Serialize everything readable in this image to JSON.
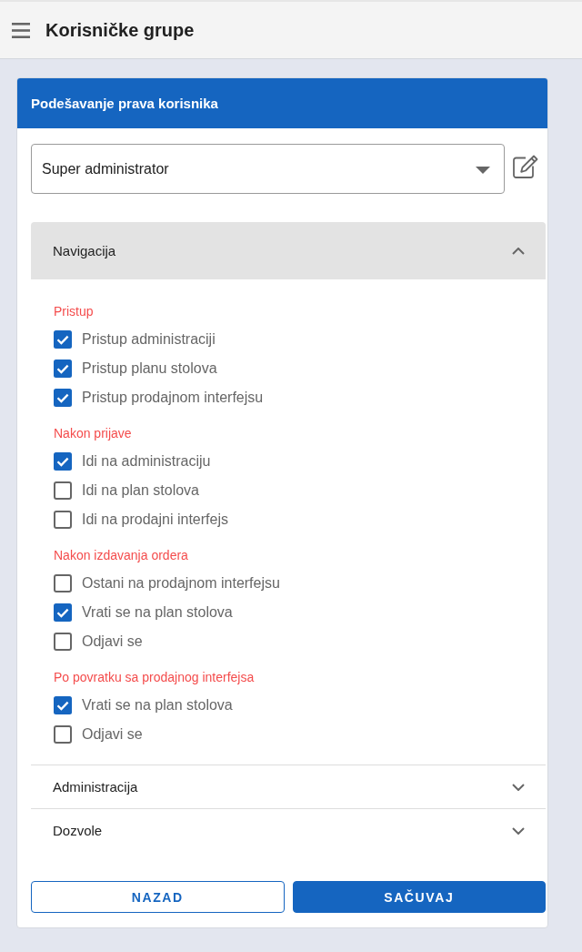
{
  "header": {
    "title": "Korisničke grupe"
  },
  "card": {
    "title": "Podešavanje prava korisnika",
    "role_select": {
      "value": "Super administrator"
    },
    "sections": [
      {
        "title": "Navigacija",
        "expanded": true,
        "groups": [
          {
            "title": "Pristup",
            "options": [
              {
                "label": "Pristup administraciji",
                "checked": true
              },
              {
                "label": "Pristup planu stolova",
                "checked": true
              },
              {
                "label": "Pristup prodajnom interfejsu",
                "checked": true
              }
            ]
          },
          {
            "title": "Nakon prijave",
            "options": [
              {
                "label": "Idi na administraciju",
                "checked": true
              },
              {
                "label": "Idi na plan stolova",
                "checked": false
              },
              {
                "label": "Idi na prodajni interfejs",
                "checked": false
              }
            ]
          },
          {
            "title": "Nakon izdavanja ordera",
            "options": [
              {
                "label": "Ostani na prodajnom interfejsu",
                "checked": false
              },
              {
                "label": "Vrati se na plan stolova",
                "checked": true
              },
              {
                "label": "Odjavi se",
                "checked": false
              }
            ]
          },
          {
            "title": "Po povratku sa prodajnog interfejsa",
            "options": [
              {
                "label": "Vrati se na plan stolova",
                "checked": true
              },
              {
                "label": "Odjavi se",
                "checked": false
              }
            ]
          }
        ]
      },
      {
        "title": "Administracija",
        "expanded": false
      },
      {
        "title": "Dozvole",
        "expanded": false
      }
    ],
    "buttons": [
      {
        "label": "NAZAD",
        "kind": "outlined"
      },
      {
        "label": "SAČUVAJ",
        "kind": "filled"
      }
    ]
  }
}
